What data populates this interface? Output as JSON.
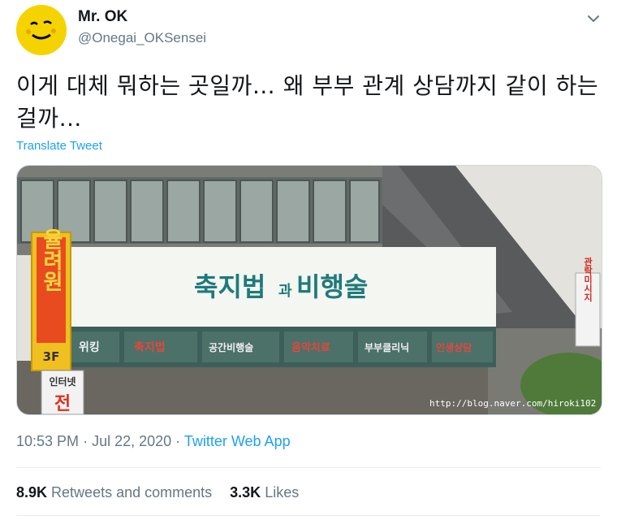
{
  "tweet": {
    "author_name": "Mr. OK",
    "author_handle": "@Onegai_OKSensei",
    "text": "이게 대체 뭐하는 곳일까… 왜 부부 관계 상담까지 같이 하는 걸까…",
    "translate_label": "Translate Tweet",
    "time": "10:53 PM",
    "date": "Jul 22, 2020",
    "separator": "·",
    "source": "Twitter Web App",
    "retweets_count": "8.9K",
    "retweets_label": "Retweets and comments",
    "likes_count": "3.3K",
    "likes_label": "Likes"
  },
  "photo": {
    "main_sign": "축지법과비행술",
    "main_sign_part1": "축지법",
    "main_sign_part2": "과",
    "main_sign_part3": "비행술",
    "panels": [
      "위킹",
      "축지법",
      "공간비행술",
      "음악치료",
      "부부클리닉",
      "인생상담"
    ],
    "vertical_sign_left": "율려원",
    "floor_label": "3F",
    "internet_sign": "인터넷",
    "bottom_sign": "전",
    "right_sign": "관락미시지",
    "watermark": "http://blog.naver.com/hiroki102"
  },
  "colors": {
    "accent": "#1da1f2",
    "muted": "#657786",
    "text": "#14171a",
    "avatar_bg": "#f5d300"
  },
  "icons": [
    "avatar-smiley-icon",
    "chevron-down-icon"
  ]
}
